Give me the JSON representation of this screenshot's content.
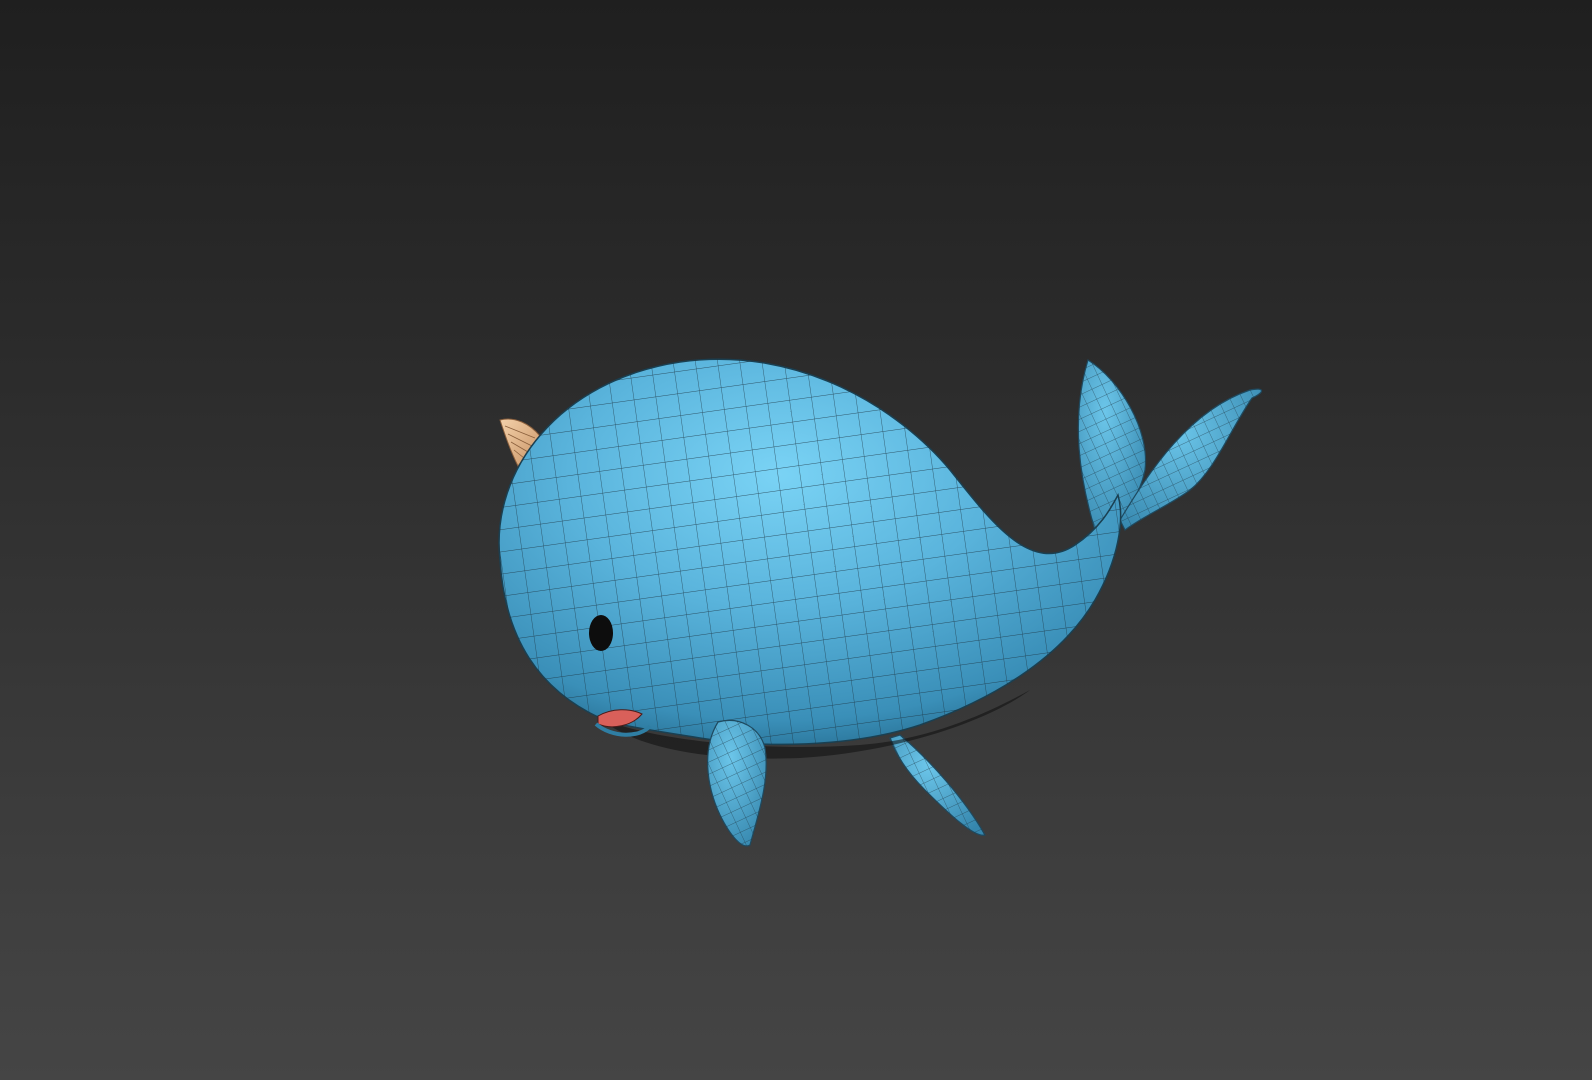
{
  "viewport": {
    "background_top": "#1f1f1f",
    "background_bottom": "#454545"
  },
  "model": {
    "name_icon": "narwhal-mesh-icon",
    "body_color": "#5ab4dc",
    "body_highlight": "#74cdf0",
    "body_shadow": "#2f7ea3",
    "horn_color": "#e6b98c",
    "mouth_color": "#d9605a",
    "eye_color": "#0d0d0d",
    "wire_color": "#1c3340"
  }
}
